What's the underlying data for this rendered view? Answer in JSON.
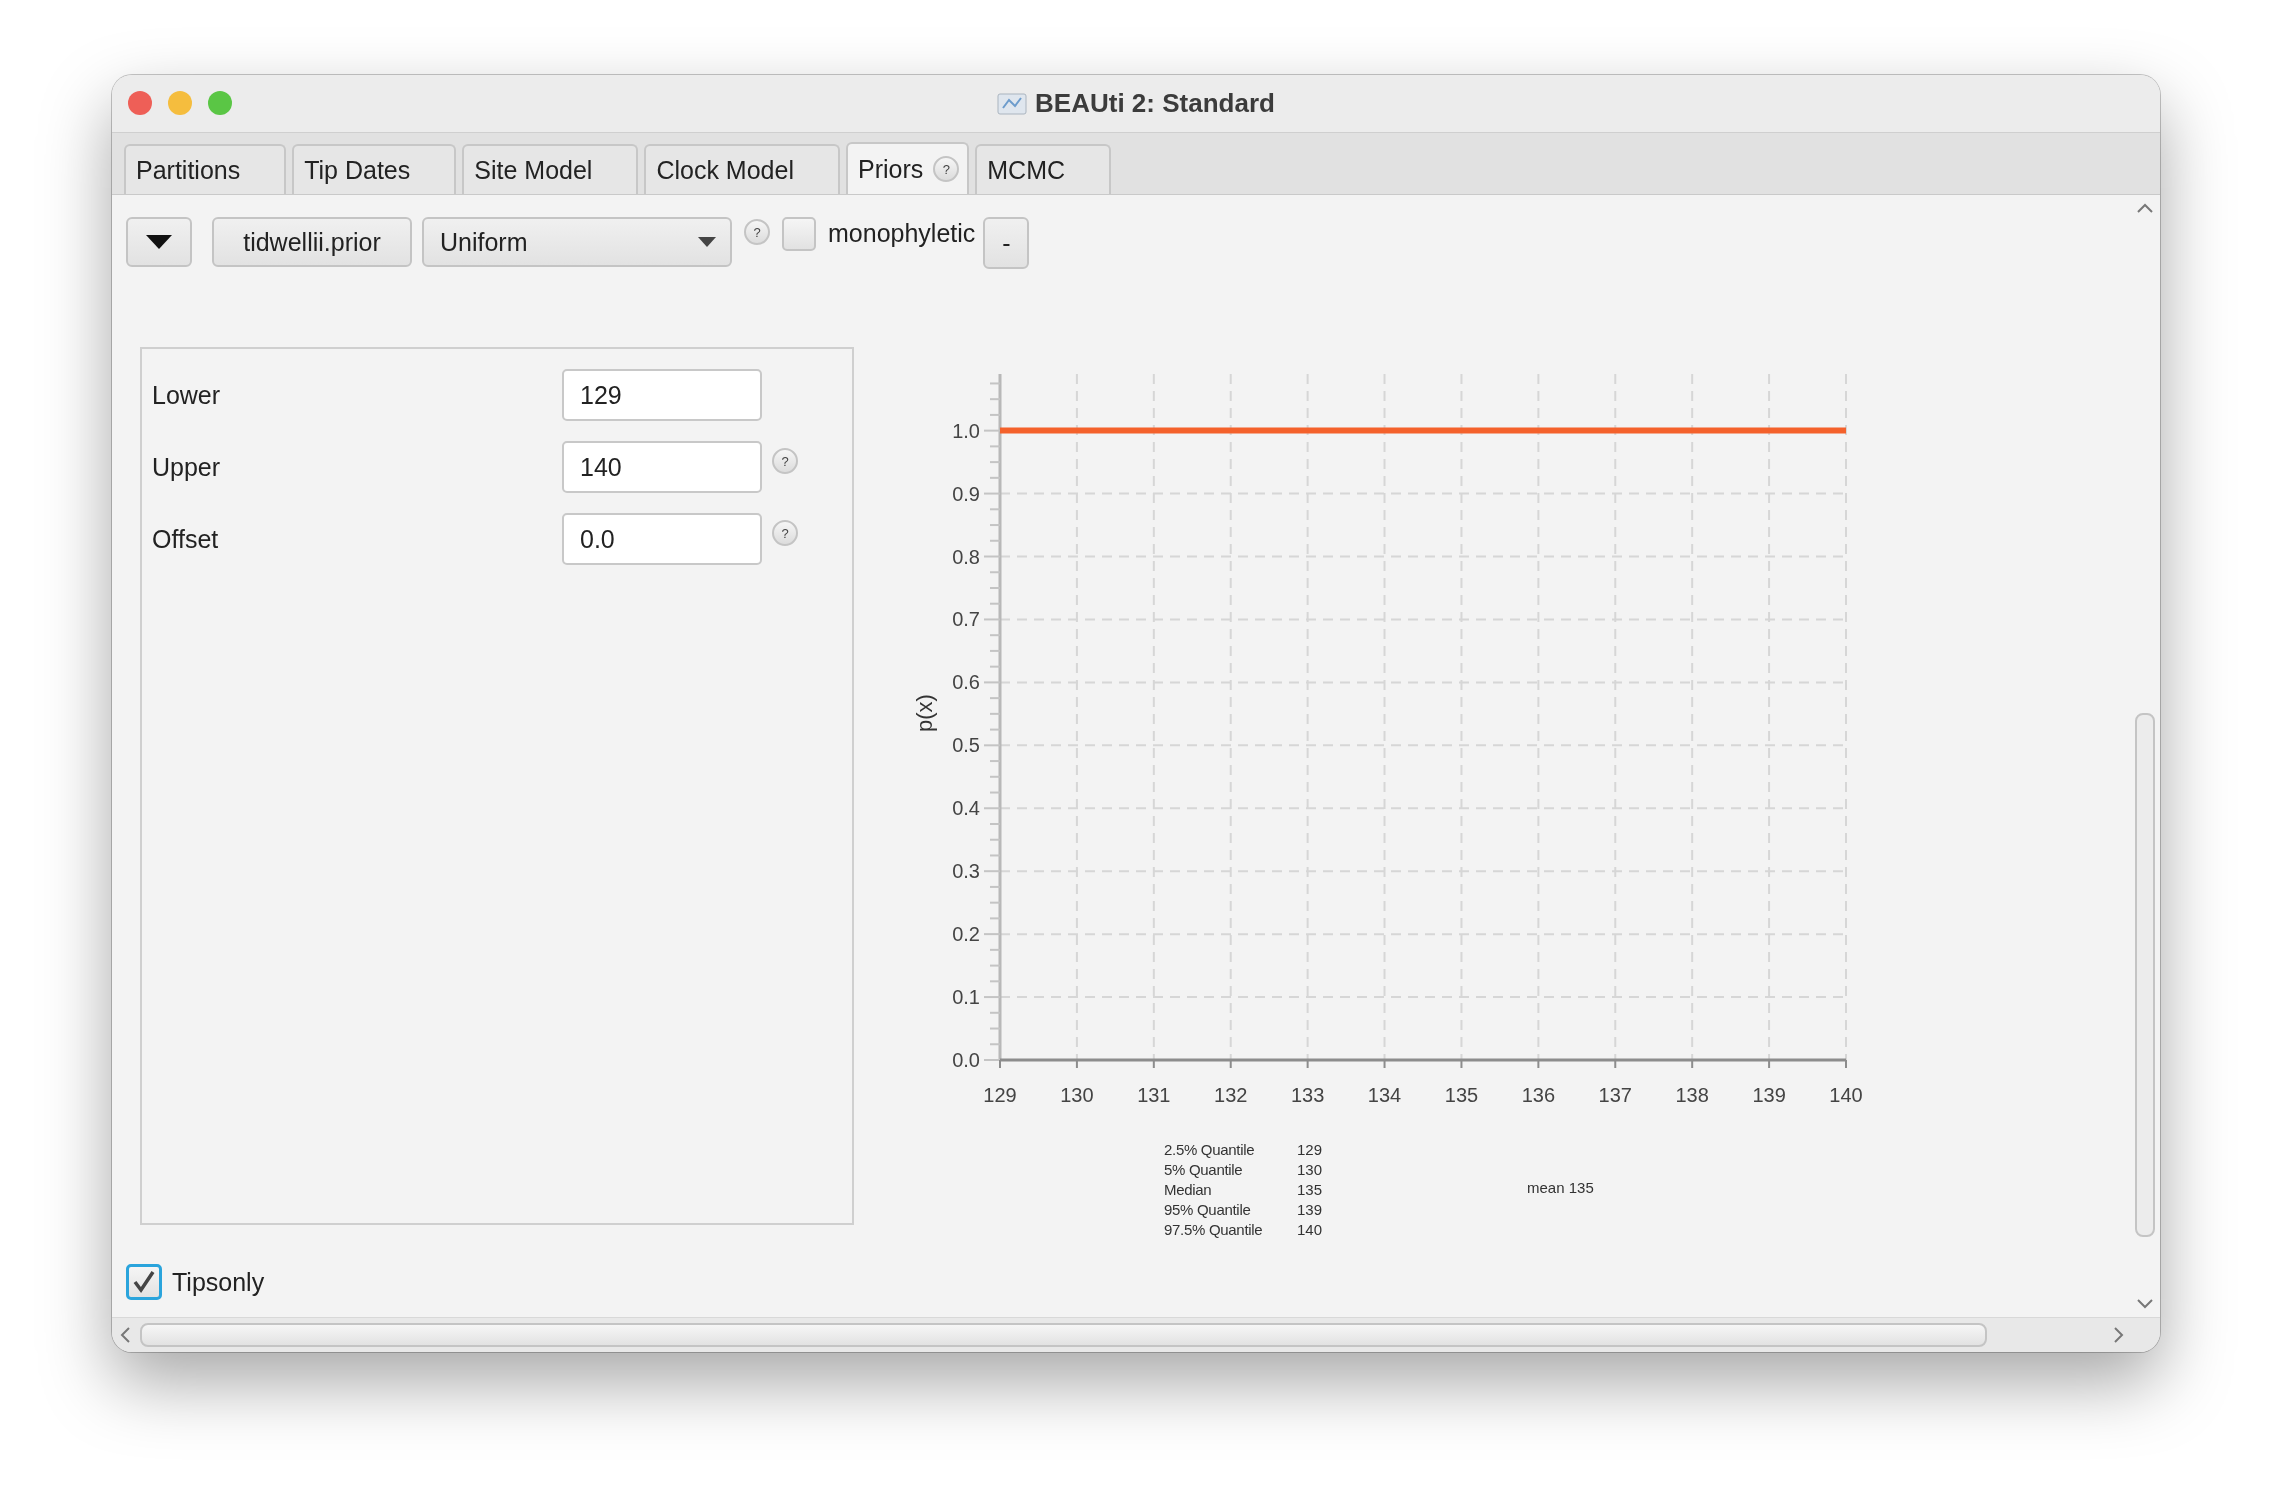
{
  "window": {
    "title": "BEAUti 2: Standard"
  },
  "help_label": "?",
  "tabs": [
    {
      "label": "Partitions",
      "selected": false,
      "help": false
    },
    {
      "label": "Tip Dates",
      "selected": false,
      "help": false
    },
    {
      "label": "Site Model",
      "selected": false,
      "help": false
    },
    {
      "label": "Clock Model",
      "selected": false,
      "help": false
    },
    {
      "label": "Priors",
      "selected": true,
      "help": true
    },
    {
      "label": "MCMC",
      "selected": false,
      "help": false
    }
  ],
  "prior_bar": {
    "name": "tidwellii.prior",
    "distribution": "Uniform",
    "monophyletic": false,
    "monophyletic_label": "monophyletic",
    "remove_label": "-"
  },
  "parameters": [
    {
      "label": "Lower",
      "value": "129",
      "help": false
    },
    {
      "label": "Upper",
      "value": "140",
      "help": true
    },
    {
      "label": "Offset",
      "value": "0.0",
      "help": true
    }
  ],
  "chart_data": {
    "type": "line",
    "ylabel": "p(x)",
    "x": [
      129,
      140
    ],
    "series": [
      {
        "color": "#f4612b",
        "values": [
          1.0,
          1.0
        ]
      }
    ],
    "grid": true,
    "xlim": [
      129,
      140
    ],
    "ylim": [
      0,
      1.09
    ],
    "xticks": [
      129,
      130,
      131,
      132,
      133,
      134,
      135,
      136,
      137,
      138,
      139,
      140
    ],
    "yticks": [
      {
        "value": 0,
        "label": "0.0"
      },
      {
        "value": 0.1,
        "label": "0.1"
      },
      {
        "value": 0.2,
        "label": "0.2"
      },
      {
        "value": 0.3,
        "label": "0.3"
      },
      {
        "value": 0.4,
        "label": "0.4"
      },
      {
        "value": 0.5,
        "label": "0.5"
      },
      {
        "value": 0.6,
        "label": "0.6"
      },
      {
        "value": 0.7,
        "label": "0.7"
      },
      {
        "value": 0.8,
        "label": "0.8"
      },
      {
        "value": 0.9,
        "label": "0.9"
      },
      {
        "value": 1,
        "label": "1.0"
      }
    ]
  },
  "quantiles": [
    {
      "label": "2.5% Quantile",
      "value": "129"
    },
    {
      "label": "5% Quantile",
      "value": "130"
    },
    {
      "label": "Median",
      "value": "135"
    },
    {
      "label": "95% Quantile",
      "value": "139"
    },
    {
      "label": "97.5% Quantile",
      "value": "140"
    }
  ],
  "mean": "mean 135",
  "tips_only": {
    "label": "Tipsonly",
    "checked": true
  }
}
